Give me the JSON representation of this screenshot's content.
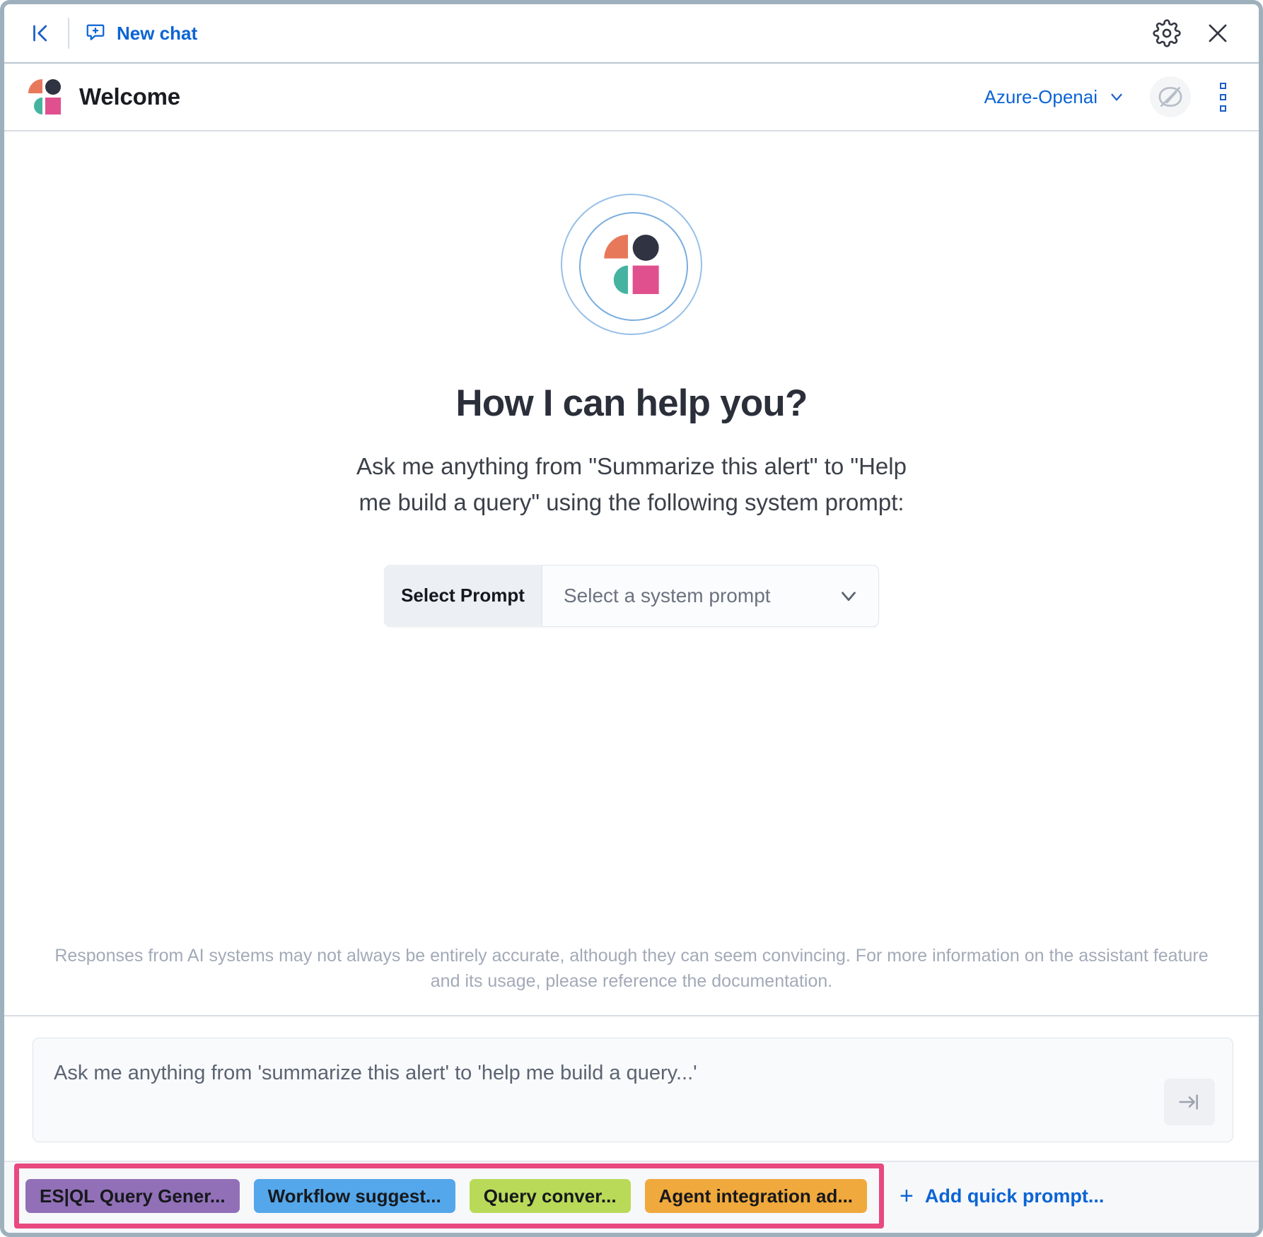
{
  "topbar": {
    "collapse_icon": "collapse-panel-icon",
    "new_chat_label": "New chat",
    "new_chat_icon": "new-comment-icon",
    "settings_icon": "gear-icon",
    "close_icon": "close-icon"
  },
  "header": {
    "logo_icon": "assistant-logo-icon",
    "title": "Welcome",
    "connector_name": "Azure-Openai",
    "connector_chevron_icon": "chevron-down-icon",
    "anonymize_icon": "eye-slash-icon",
    "menu_icon": "vertical-dots-icon"
  },
  "empty_state": {
    "avatar_icon": "assistant-avatar-icon",
    "title": "How I can help you?",
    "subtitle": "Ask me anything from \"Summarize this alert\" to \"Help me build a query\" using the following system prompt:",
    "prompt_selector": {
      "label": "Select Prompt",
      "placeholder": "Select a system prompt",
      "chevron_icon": "chevron-down-icon"
    }
  },
  "disclaimer": "Responses from AI systems may not always be entirely accurate, although they can seem convincing. For more information on the assistant feature and its usage, please reference the documentation.",
  "composer": {
    "placeholder": "Ask me anything from 'summarize this alert' to 'help me build a query...'",
    "value": "",
    "send_icon": "submit-arrow-icon"
  },
  "quick_prompts": {
    "highlight_color": "#e8497e",
    "chips": [
      {
        "label": "ES|QL Query Gener...",
        "color": "#9170b8"
      },
      {
        "label": "Workflow suggest...",
        "color": "#54a7ea"
      },
      {
        "label": "Query conver...",
        "color": "#b9da59"
      },
      {
        "label": "Agent integration ad...",
        "color": "#f0a93c"
      }
    ],
    "add_label": "Add quick prompt...",
    "add_icon": "plus-icon"
  },
  "colors": {
    "link": "#0b64d4",
    "brand_orange": "#e8785a",
    "brand_teal": "#45b3a0",
    "brand_pink": "#e0508f",
    "brand_dark": "#2f3342"
  }
}
